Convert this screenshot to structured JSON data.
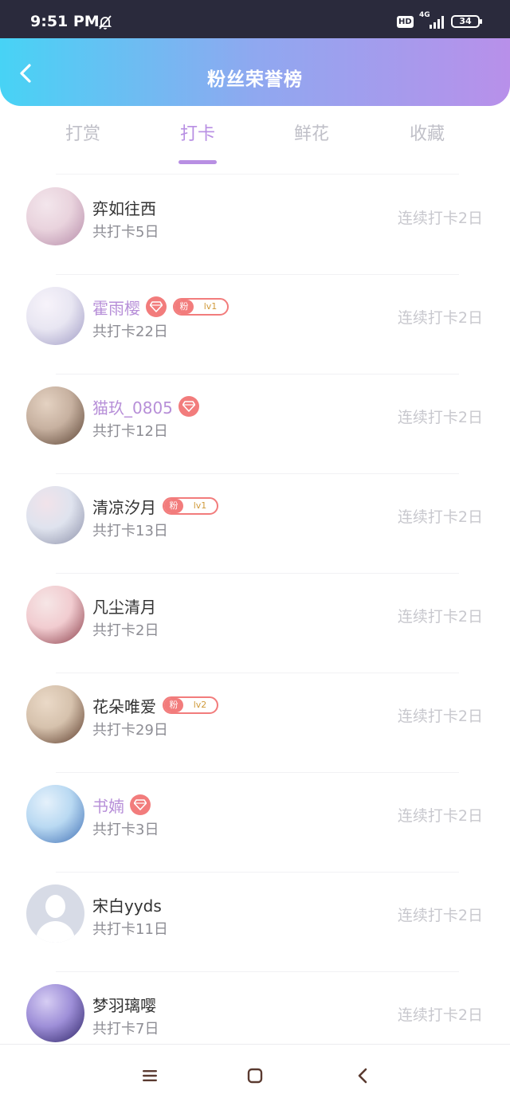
{
  "status_bar": {
    "time": "9:51 PM",
    "hd": "HD",
    "network": "4G",
    "battery": "34"
  },
  "header": {
    "title": "粉丝荣誉榜"
  },
  "tabs": [
    {
      "label": "打赏",
      "active": false
    },
    {
      "label": "打卡",
      "active": true
    },
    {
      "label": "鲜花",
      "active": false
    },
    {
      "label": "收藏",
      "active": false
    }
  ],
  "fans": [
    {
      "name": "弈如往西",
      "vip": false,
      "gem": false,
      "fan_badge": null,
      "total": "共打卡5日",
      "streak": "连续打卡2日",
      "avatar_colors": [
        "#e9d3dd",
        "#b58aa8",
        "#f3e6ec"
      ]
    },
    {
      "name": "霍雨樱",
      "vip": true,
      "gem": true,
      "fan_badge": {
        "label": "粉",
        "level": "lv1"
      },
      "total": "共打卡22日",
      "streak": "连续打卡2日",
      "avatar_colors": [
        "#e8e6f2",
        "#9f9ac4",
        "#f7f3fa"
      ]
    },
    {
      "name": "猫玖_0805",
      "vip": true,
      "gem": true,
      "fan_badge": null,
      "total": "共打卡12日",
      "streak": "连续打卡2日",
      "avatar_colors": [
        "#c7b1a0",
        "#5a4233",
        "#e4d2c2"
      ]
    },
    {
      "name": "清凉汐月",
      "vip": false,
      "gem": false,
      "fan_badge": {
        "label": "粉",
        "level": "lv1"
      },
      "total": "共打卡13日",
      "streak": "连续打卡2日",
      "avatar_colors": [
        "#dfe3ee",
        "#8b8fa8",
        "#f1e3ea"
      ]
    },
    {
      "name": "凡尘清月",
      "vip": false,
      "gem": false,
      "fan_badge": null,
      "total": "共打卡2日",
      "streak": "连续打卡2日",
      "avatar_colors": [
        "#f1ccd0",
        "#8a3c48",
        "#f6e6e6"
      ]
    },
    {
      "name": "花朵唯爱",
      "vip": false,
      "gem": false,
      "fan_badge": {
        "label": "粉",
        "level": "lv2"
      },
      "total": "共打卡29日",
      "streak": "连续打卡2日",
      "avatar_colors": [
        "#d6c2ad",
        "#5b3a2a",
        "#ead9c7"
      ]
    },
    {
      "name": "书婻",
      "vip": true,
      "gem": true,
      "fan_badge": null,
      "total": "共打卡3日",
      "streak": "连续打卡2日",
      "avatar_colors": [
        "#b9d9f2",
        "#3f6fb5",
        "#e5f1fb"
      ]
    },
    {
      "name": "宋白yyds",
      "vip": false,
      "gem": false,
      "fan_badge": null,
      "total": "共打卡11日",
      "streak": "连续打卡2日",
      "avatar_colors": null
    },
    {
      "name": "梦羽璃嘤",
      "vip": false,
      "gem": false,
      "fan_badge": null,
      "total": "共打卡7日",
      "streak": "连续打卡2日",
      "avatar_colors": [
        "#9e8fd8",
        "#2d2366",
        "#d6cdf3"
      ]
    }
  ],
  "nav": {
    "icons": [
      "menu-icon",
      "home-square-icon",
      "back-triangle-icon"
    ]
  },
  "colors": {
    "accent": "#b88fe3",
    "badge_red": "#f27c7c",
    "header_start": "#47d3f5",
    "header_end": "#b890ea"
  }
}
